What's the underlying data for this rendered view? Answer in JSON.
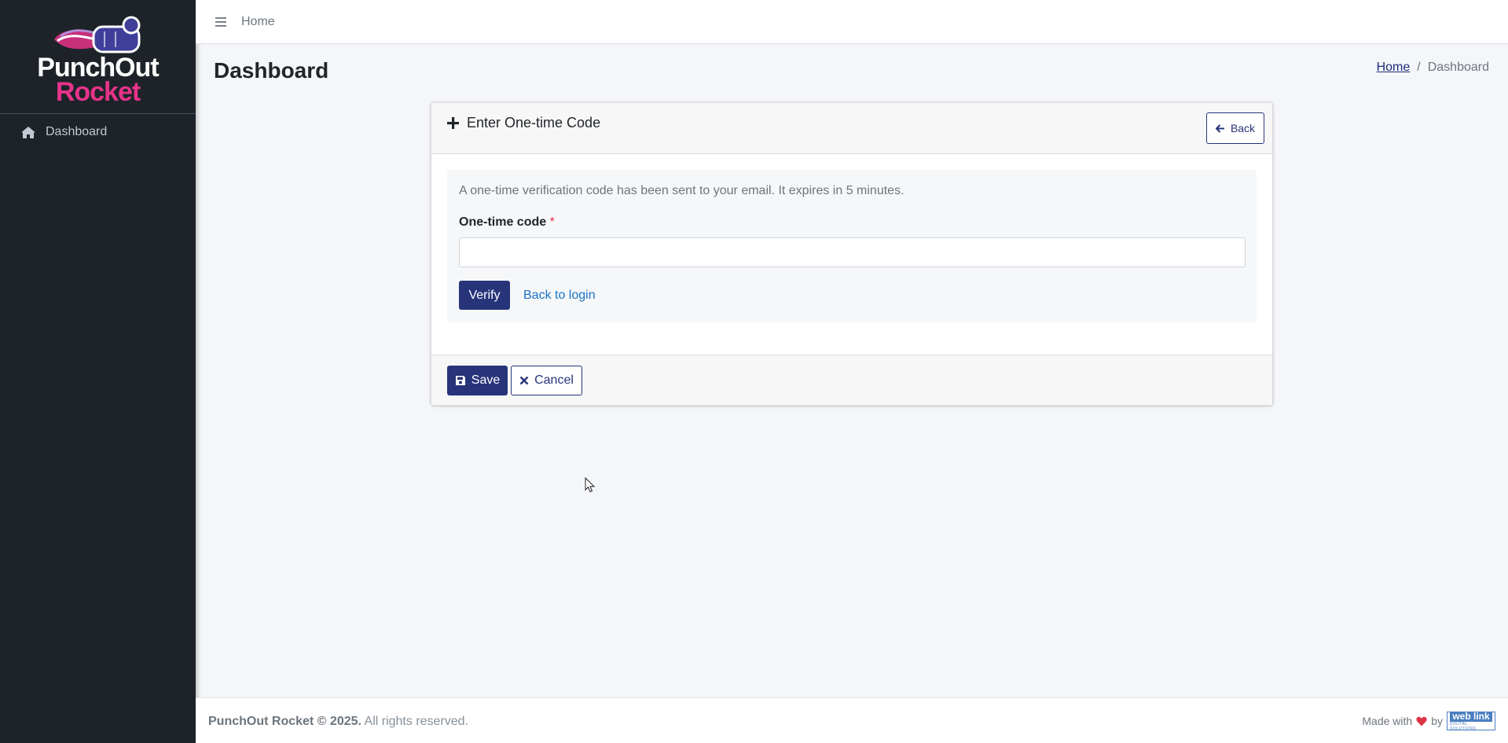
{
  "brand": {
    "line1": "PunchOut",
    "line2": "Rocket",
    "colors": {
      "line1": "#ffffff",
      "line2": "#e6338a",
      "sidebar_bg": "#1d2329"
    }
  },
  "sidebar": {
    "items": [
      {
        "label": "Dashboard",
        "icon": "home-icon"
      }
    ]
  },
  "topbar": {
    "menu_icon": "hamburger-icon",
    "home_label": "Home"
  },
  "page": {
    "title": "Dashboard",
    "breadcrumb": {
      "home": "Home",
      "separator": "/",
      "current": "Dashboard"
    }
  },
  "card": {
    "header_icon": "plus-icon",
    "title": "Enter One-time Code",
    "back_label": "Back",
    "info_text": "A one-time verification code has been sent to your email. It expires in 5 minutes.",
    "field_label": "One-time code",
    "required_mark": "*",
    "input_value": "",
    "verify_label": "Verify",
    "back_to_login_label": "Back to login",
    "save_label": "Save",
    "cancel_label": "Cancel"
  },
  "footer": {
    "copyright_bold": "PunchOut Rocket © 2025.",
    "copyright_rest": " All rights reserved.",
    "made_with": "Made with",
    "by": "by",
    "logo_main": "web link",
    "logo_sub": "DIGITAL SOLUTIONS",
    "heart_color": "#dc3545"
  },
  "colors": {
    "primary": "#27347a",
    "link": "#1a73c9",
    "required": "#dc3545"
  }
}
